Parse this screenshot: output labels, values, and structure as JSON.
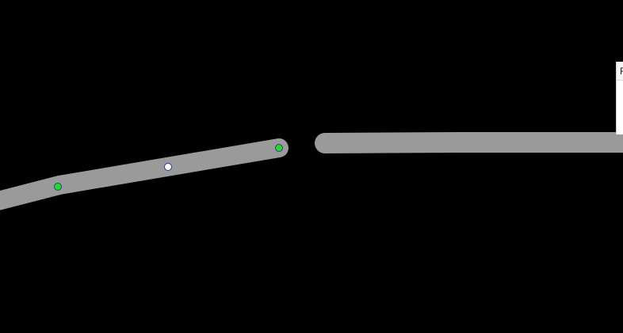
{
  "editor": {
    "background_color": "#000000",
    "track_color": "#9a9a9a",
    "handle_colors": {
      "anchor": "#22dd22",
      "midpoint": "#ffffff",
      "outline": "#2a3a9a"
    }
  },
  "panel": {
    "header_label": "F"
  }
}
